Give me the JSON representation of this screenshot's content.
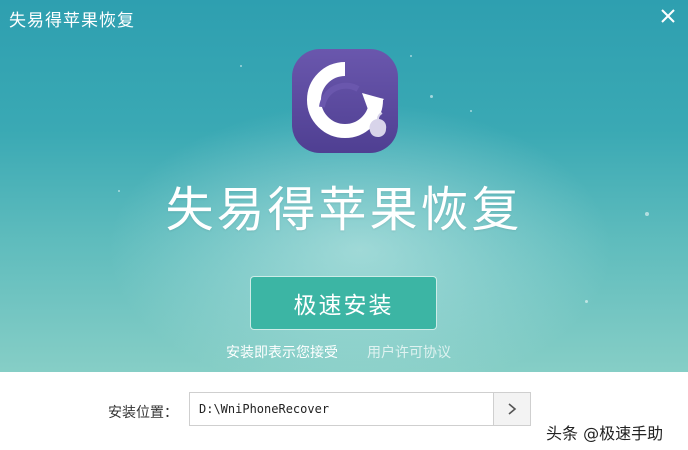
{
  "window": {
    "title": "失易得苹果恢复",
    "close_icon": "close-icon"
  },
  "hero": {
    "app_icon": "recovery-logo-icon",
    "app_name": "失易得苹果恢复",
    "install_button_label": "极速安装",
    "agree_text": "安装即表示您接受",
    "license_link": "用户许可协议"
  },
  "install_path": {
    "label": "安装位置：",
    "value": "D:\\WniPhoneRecover",
    "browse_icon": "chevron-right-icon"
  },
  "watermark": {
    "text": "头条 @极速手助"
  },
  "colors": {
    "hero_top": "#2e9fb0",
    "hero_bottom": "#86cec6",
    "install_button": "#3cb5a4",
    "logo_purple": "#5c4a9e"
  }
}
